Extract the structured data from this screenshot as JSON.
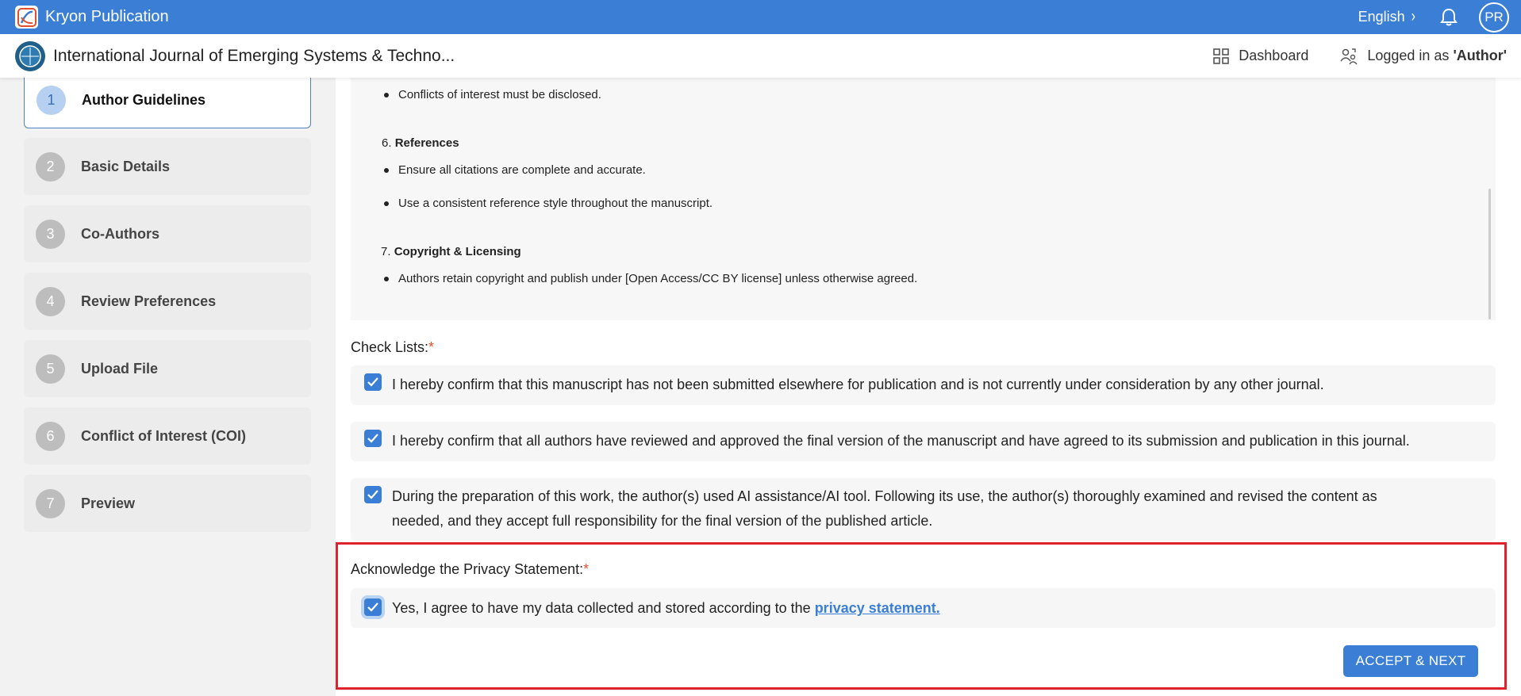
{
  "topbar": {
    "brand_name": "Kryon Publication",
    "language": "English",
    "avatar_initials": "PR",
    "color": "#3a7fd5"
  },
  "header": {
    "journal_title": "International Journal of Emerging Systems & Techno...",
    "dashboard_label": "Dashboard",
    "logged_in_prefix": "Logged in as",
    "logged_in_role": "'Author'"
  },
  "steps": [
    {
      "num": "1",
      "label": "Author Guidelines",
      "active": true
    },
    {
      "num": "2",
      "label": "Basic Details"
    },
    {
      "num": "3",
      "label": "Co-Authors"
    },
    {
      "num": "4",
      "label": "Review Preferences"
    },
    {
      "num": "5",
      "label": "Upload File"
    },
    {
      "num": "6",
      "label": "Conflict of Interest (COI)"
    },
    {
      "num": "7",
      "label": "Preview"
    }
  ],
  "guidelines": {
    "item5_bullet": "Conflicts of interest must be disclosed.",
    "item6_num": "6.",
    "item6_title": "References",
    "item6_bullets": [
      "Ensure all citations are complete and accurate.",
      "Use a consistent reference style throughout the manuscript."
    ],
    "item7_num": "7.",
    "item7_title": "Copyright & Licensing",
    "item7_bullets": [
      "Authors retain copyright and publish under [Open Access/CC BY license] unless otherwise agreed."
    ]
  },
  "checklists": {
    "label": "Check Lists:",
    "required_mark": "*",
    "items": [
      {
        "text": "I hereby confirm that this manuscript has not been submitted elsewhere for publication and is not currently under consideration by any other journal.",
        "checked": true
      },
      {
        "text": "I hereby confirm that all authors have reviewed and approved the final version of the manuscript and have agreed to its submission and publication in this journal.",
        "checked": true
      },
      {
        "text_line1": "During the preparation of this work, the author(s) used AI assistance/AI tool. Following its use, the author(s) thoroughly examined and revised the content as",
        "text_line2": "needed, and they accept full responsibility for the final version of the published article.",
        "checked": true
      }
    ]
  },
  "privacy": {
    "label": "Acknowledge the Privacy Statement:",
    "required_mark": "*",
    "agree_text": "Yes, I agree to have my data collected and stored according to the",
    "link_text": "privacy statement.",
    "checked": true
  },
  "actions": {
    "next_label": "ACCEPT & NEXT"
  }
}
